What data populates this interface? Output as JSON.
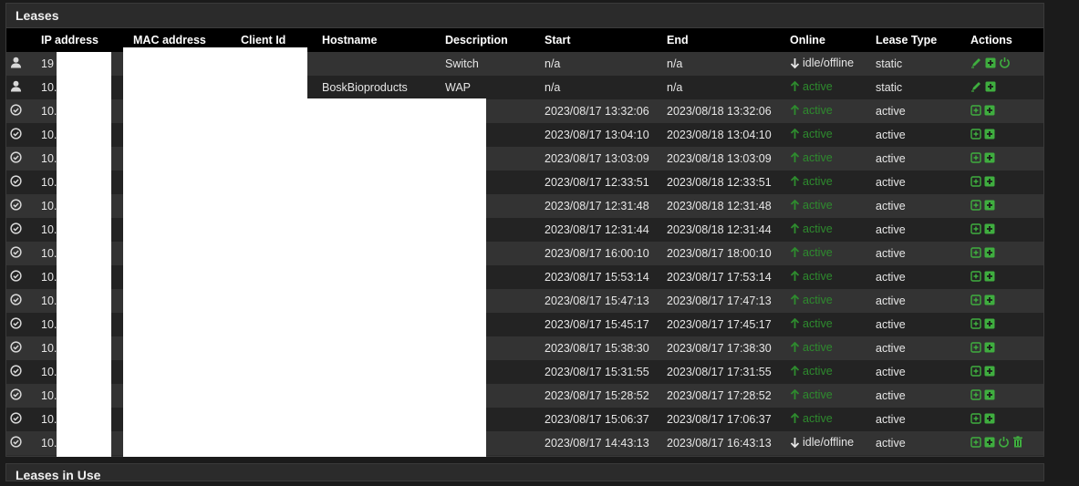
{
  "panel": {
    "title": "Leases"
  },
  "bottom_panel": {
    "title": "Leases in Use"
  },
  "columns": [
    "",
    "IP address",
    "MAC address",
    "Client Id",
    "Hostname",
    "Description",
    "Start",
    "End",
    "Online",
    "Lease Type",
    "Actions"
  ],
  "rows": [
    {
      "icon": "user",
      "ip": "19",
      "hostname": "",
      "description": "Switch",
      "start": "n/a",
      "end": "n/a",
      "online": "idle/offline",
      "online_state": "offline",
      "lease_type": "static",
      "actions": [
        "edit",
        "add",
        "wake"
      ]
    },
    {
      "icon": "user",
      "ip": "10.",
      "hostname": "BoskBioproducts",
      "description": "WAP",
      "start": "n/a",
      "end": "n/a",
      "online": "active",
      "online_state": "active",
      "lease_type": "static",
      "actions": [
        "edit",
        "add"
      ]
    },
    {
      "icon": "check",
      "ip": "10.",
      "hostname": "",
      "description": "",
      "start": "2023/08/17 13:32:06",
      "end": "2023/08/18 13:32:06",
      "online": "active",
      "online_state": "active",
      "lease_type": "active",
      "actions": [
        "add-outline",
        "add"
      ]
    },
    {
      "icon": "check",
      "ip": "10.",
      "hostname": "",
      "description": "",
      "start": "2023/08/17 13:04:10",
      "end": "2023/08/18 13:04:10",
      "online": "active",
      "online_state": "active",
      "lease_type": "active",
      "actions": [
        "add-outline",
        "add"
      ]
    },
    {
      "icon": "check",
      "ip": "10.",
      "hostname": "",
      "description": "",
      "start": "2023/08/17 13:03:09",
      "end": "2023/08/18 13:03:09",
      "online": "active",
      "online_state": "active",
      "lease_type": "active",
      "actions": [
        "add-outline",
        "add"
      ]
    },
    {
      "icon": "check",
      "ip": "10.",
      "hostname": "",
      "description": "",
      "start": "2023/08/17 12:33:51",
      "end": "2023/08/18 12:33:51",
      "online": "active",
      "online_state": "active",
      "lease_type": "active",
      "actions": [
        "add-outline",
        "add"
      ]
    },
    {
      "icon": "check",
      "ip": "10.",
      "hostname": "",
      "description": "",
      "start": "2023/08/17 12:31:48",
      "end": "2023/08/18 12:31:48",
      "online": "active",
      "online_state": "active",
      "lease_type": "active",
      "actions": [
        "add-outline",
        "add"
      ]
    },
    {
      "icon": "check",
      "ip": "10.",
      "hostname": "",
      "description": "",
      "start": "2023/08/17 12:31:44",
      "end": "2023/08/18 12:31:44",
      "online": "active",
      "online_state": "active",
      "lease_type": "active",
      "actions": [
        "add-outline",
        "add"
      ]
    },
    {
      "icon": "check",
      "ip": "10.",
      "hostname": "",
      "description": "",
      "start": "2023/08/17 16:00:10",
      "end": "2023/08/17 18:00:10",
      "online": "active",
      "online_state": "active",
      "lease_type": "active",
      "actions": [
        "add-outline",
        "add"
      ]
    },
    {
      "icon": "check",
      "ip": "10.",
      "hostname": "",
      "description": "",
      "start": "2023/08/17 15:53:14",
      "end": "2023/08/17 17:53:14",
      "online": "active",
      "online_state": "active",
      "lease_type": "active",
      "actions": [
        "add-outline",
        "add"
      ]
    },
    {
      "icon": "check",
      "ip": "10.",
      "hostname": "",
      "description": "",
      "start": "2023/08/17 15:47:13",
      "end": "2023/08/17 17:47:13",
      "online": "active",
      "online_state": "active",
      "lease_type": "active",
      "actions": [
        "add-outline",
        "add"
      ]
    },
    {
      "icon": "check",
      "ip": "10.",
      "hostname": "",
      "description": "",
      "start": "2023/08/17 15:45:17",
      "end": "2023/08/17 17:45:17",
      "online": "active",
      "online_state": "active",
      "lease_type": "active",
      "actions": [
        "add-outline",
        "add"
      ]
    },
    {
      "icon": "check",
      "ip": "10.",
      "hostname": "",
      "description": "",
      "start": "2023/08/17 15:38:30",
      "end": "2023/08/17 17:38:30",
      "online": "active",
      "online_state": "active",
      "lease_type": "active",
      "actions": [
        "add-outline",
        "add"
      ]
    },
    {
      "icon": "check",
      "ip": "10.",
      "hostname": "",
      "description": "",
      "start": "2023/08/17 15:31:55",
      "end": "2023/08/17 17:31:55",
      "online": "active",
      "online_state": "active",
      "lease_type": "active",
      "actions": [
        "add-outline",
        "add"
      ]
    },
    {
      "icon": "check",
      "ip": "10.",
      "hostname": "",
      "description": "",
      "start": "2023/08/17 15:28:52",
      "end": "2023/08/17 17:28:52",
      "online": "active",
      "online_state": "active",
      "lease_type": "active",
      "actions": [
        "add-outline",
        "add"
      ]
    },
    {
      "icon": "check",
      "ip": "10.",
      "hostname": "",
      "description": "",
      "start": "2023/08/17 15:06:37",
      "end": "2023/08/17 17:06:37",
      "online": "active",
      "online_state": "active",
      "lease_type": "active",
      "actions": [
        "add-outline",
        "add"
      ]
    },
    {
      "icon": "check",
      "ip": "10.",
      "hostname": "",
      "description": "",
      "start": "2023/08/17 14:43:13",
      "end": "2023/08/17 16:43:13",
      "online": "idle/offline",
      "online_state": "offline",
      "lease_type": "active",
      "actions": [
        "add-outline",
        "add",
        "wake",
        "delete"
      ]
    }
  ],
  "colors": {
    "accent_green": "#2e8b2e",
    "icon_green": "#3fae3f",
    "header_bg": "#000000",
    "row_odd": "#333333",
    "row_even": "#232323"
  }
}
